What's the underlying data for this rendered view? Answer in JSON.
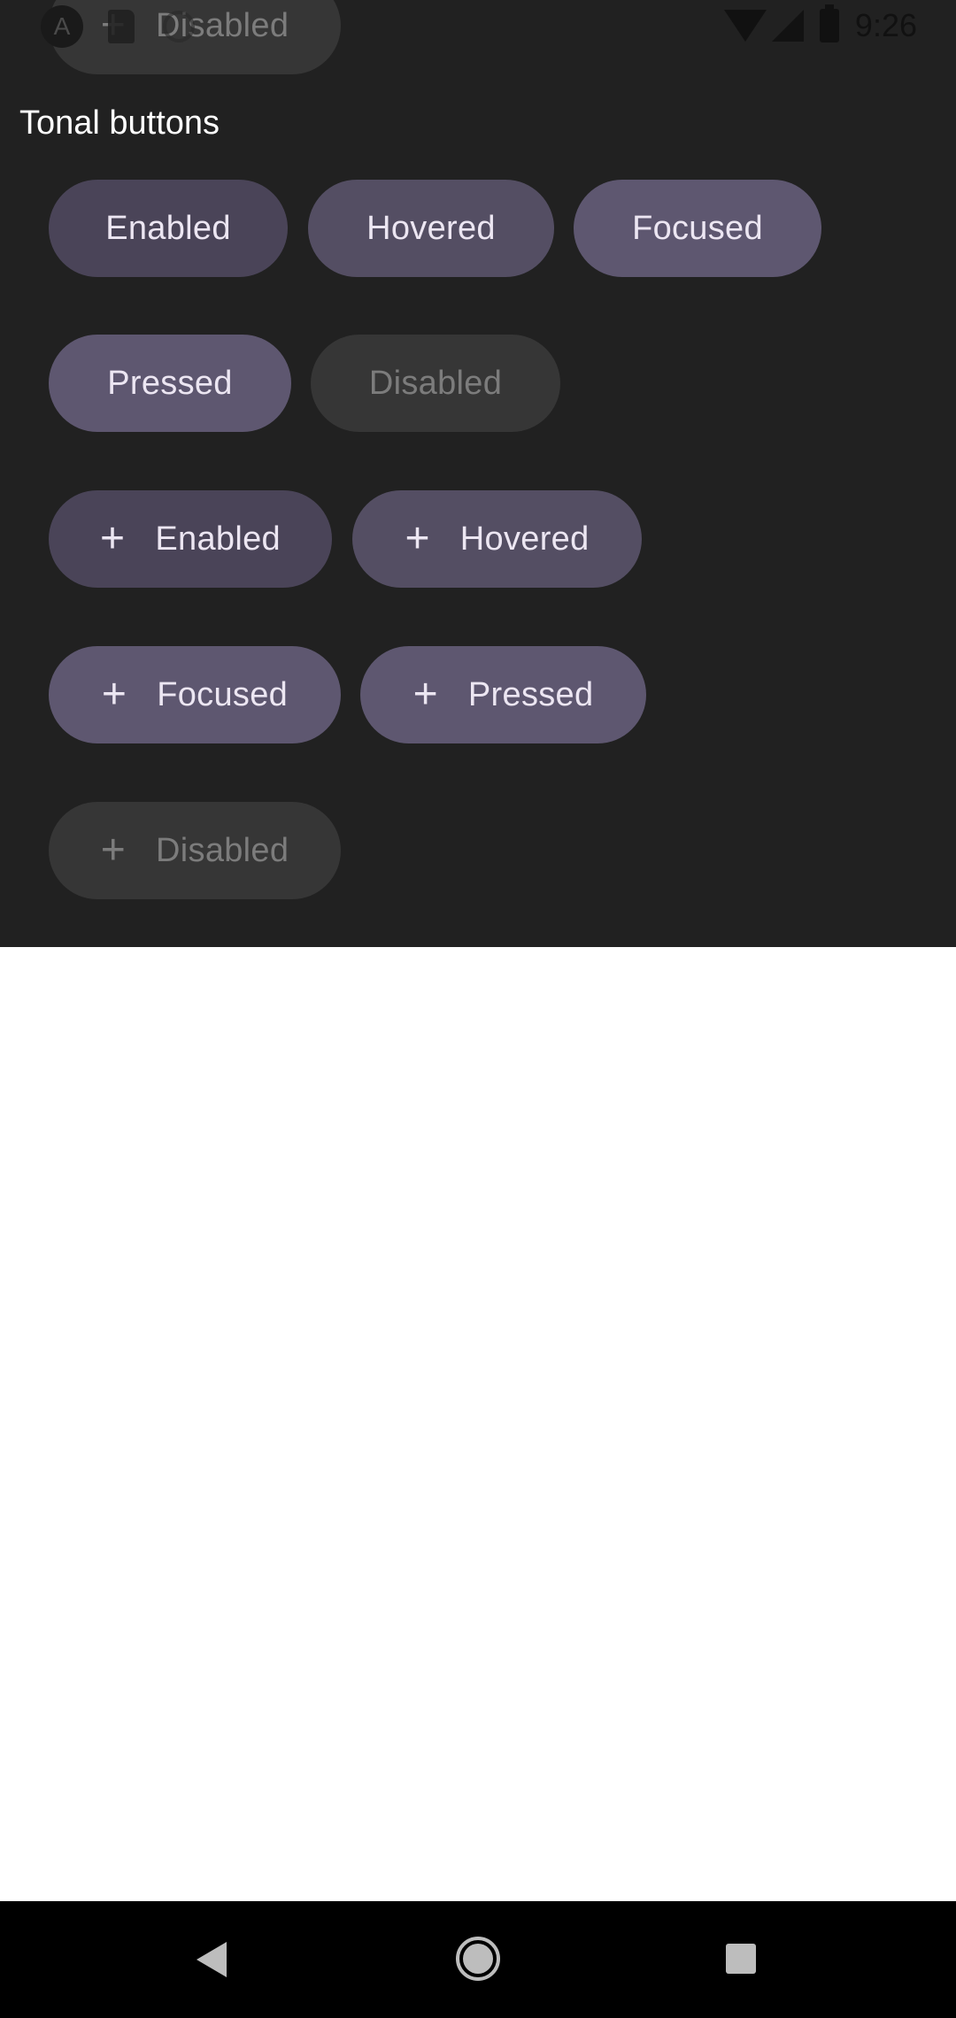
{
  "status_bar": {
    "time": "9:26",
    "app_icon": "A"
  },
  "partial_top_button": {
    "icon": "+",
    "label": "Disabled"
  },
  "section": {
    "title": "Tonal buttons"
  },
  "buttons": {
    "enabled": "Enabled",
    "hovered": "Hovered",
    "focused": "Focused",
    "pressed": "Pressed",
    "disabled": "Disabled"
  },
  "icon_buttons": {
    "icon": "+",
    "enabled": "Enabled",
    "hovered": "Hovered",
    "focused": "Focused",
    "pressed": "Pressed",
    "disabled": "Disabled"
  },
  "colors": {
    "background_dark": "#212121",
    "tonal_enabled": "#4a4458",
    "tonal_hovered": "#544e63",
    "tonal_focused": "#5e5770",
    "tonal_disabled": "#363636",
    "text_on_tonal": "#ece6f2"
  },
  "navigation": {
    "icons": [
      "back-icon",
      "home-icon",
      "recents-icon"
    ]
  }
}
